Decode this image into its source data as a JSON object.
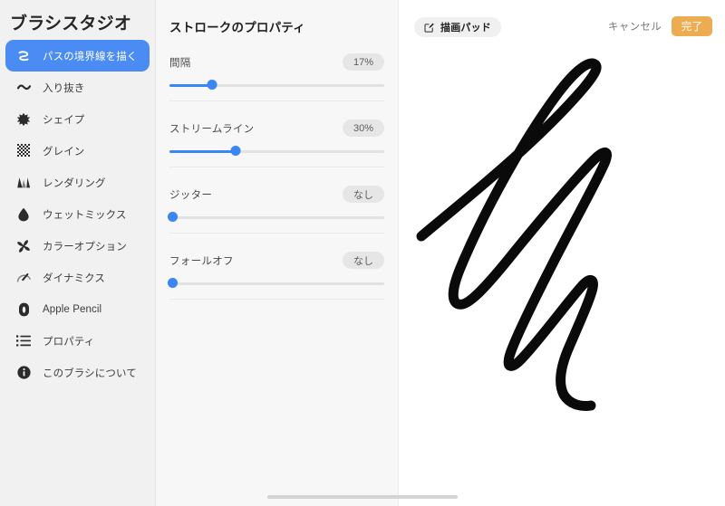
{
  "sidebar": {
    "title": "ブラシスタジオ",
    "items": [
      {
        "label": "パスの境界線を描く",
        "icon": "stroke-path-icon",
        "selected": true
      },
      {
        "label": "入り抜き",
        "icon": "taper-icon",
        "selected": false
      },
      {
        "label": "シェイプ",
        "icon": "shape-icon",
        "selected": false
      },
      {
        "label": "グレイン",
        "icon": "grain-icon",
        "selected": false
      },
      {
        "label": "レンダリング",
        "icon": "rendering-icon",
        "selected": false
      },
      {
        "label": "ウェットミックス",
        "icon": "wet-mix-droplet-icon",
        "selected": false
      },
      {
        "label": "カラーオプション",
        "icon": "color-options-icon",
        "selected": false
      },
      {
        "label": "ダイナミクス",
        "icon": "dynamics-gauge-icon",
        "selected": false
      },
      {
        "label": "Apple Pencil",
        "icon": "apple-pencil-icon",
        "selected": false
      },
      {
        "label": "プロパティ",
        "icon": "properties-list-icon",
        "selected": false
      },
      {
        "label": "このブラシについて",
        "icon": "about-info-icon",
        "selected": false
      }
    ]
  },
  "properties": {
    "title": "ストロークのプロパティ",
    "sliders": [
      {
        "label": "間隔",
        "value": "17%",
        "percent": 20
      },
      {
        "label": "ストリームライン",
        "value": "30%",
        "percent": 31
      },
      {
        "label": "ジッター",
        "value": "なし",
        "percent": 0
      },
      {
        "label": "フォールオフ",
        "value": "なし",
        "percent": 0
      }
    ]
  },
  "canvas": {
    "drawpad_label": "描画パッド",
    "drawpad_icon": "pencil-square-icon",
    "cancel_label": "キャンセル",
    "done_label": "完了"
  },
  "colors": {
    "accent_blue": "#3a86f5",
    "selected_blue": "#4a8cf3",
    "done_orange": "#edab52",
    "sidebar_bg": "#f1f1f1",
    "panel_bg": "#f7f7f7",
    "stroke_black": "#0a0a0a"
  }
}
